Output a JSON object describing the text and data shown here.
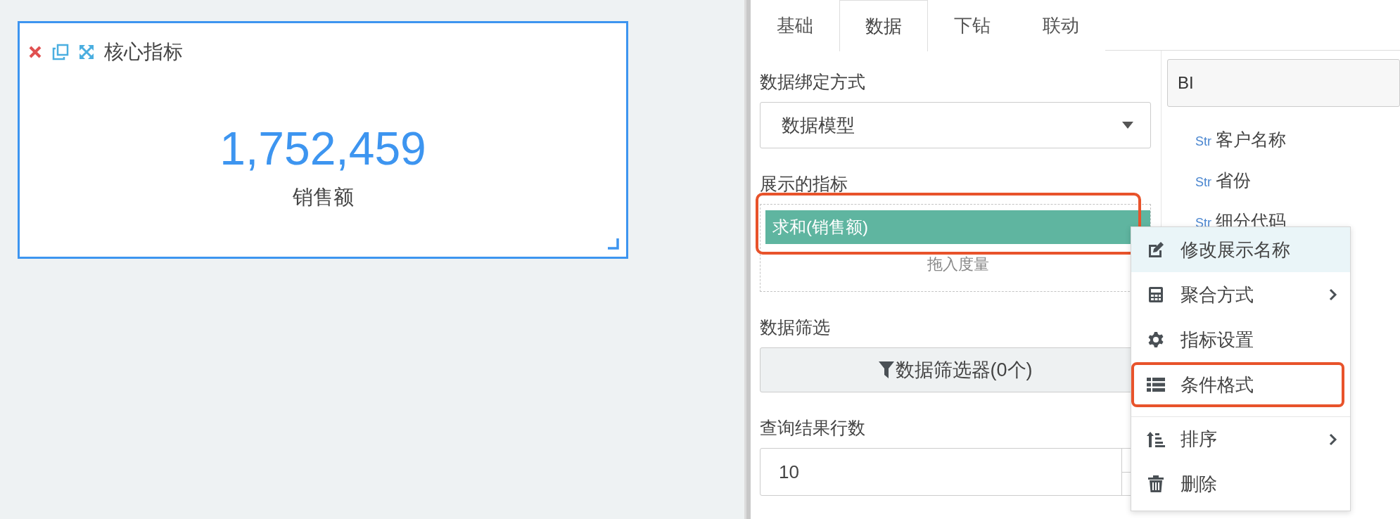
{
  "card": {
    "title": "核心指标",
    "value": "1,752,459",
    "label": "销售额"
  },
  "tabs": [
    {
      "label": "基础",
      "selected": false
    },
    {
      "label": "数据",
      "selected": true
    },
    {
      "label": "下钻",
      "selected": false
    },
    {
      "label": "联动",
      "selected": false
    }
  ],
  "binding": {
    "label": "数据绑定方式",
    "value": "数据模型"
  },
  "measures": {
    "label": "展示的指标",
    "items": [
      {
        "text": "求和(销售额)",
        "annotated": true
      }
    ],
    "placeholder": "拖入度量"
  },
  "filter": {
    "label": "数据筛选",
    "button": "数据筛选器(0个)"
  },
  "rows": {
    "label": "查询结果行数",
    "value": "10"
  },
  "fields": {
    "search": "BI",
    "items": [
      {
        "type": "Str",
        "name": "客户名称"
      },
      {
        "type": "Str",
        "name": "省份"
      },
      {
        "type": "Str",
        "name": "细分代码"
      }
    ]
  },
  "menu": [
    {
      "label": "修改展示名称",
      "kind": "edit",
      "hover": true,
      "submenu": false,
      "annotated": false,
      "divider_before": false
    },
    {
      "label": "聚合方式",
      "kind": "calculator",
      "hover": false,
      "submenu": true,
      "annotated": false,
      "divider_before": false
    },
    {
      "label": "指标设置",
      "kind": "gear",
      "hover": false,
      "submenu": false,
      "annotated": false,
      "divider_before": false
    },
    {
      "label": "条件格式",
      "kind": "list",
      "hover": false,
      "submenu": false,
      "annotated": true,
      "divider_before": false
    },
    {
      "label": "排序",
      "kind": "sort",
      "hover": false,
      "submenu": true,
      "annotated": false,
      "divider_before": true
    },
    {
      "label": "删除",
      "kind": "trash",
      "hover": false,
      "submenu": false,
      "annotated": false,
      "divider_before": false
    }
  ]
}
